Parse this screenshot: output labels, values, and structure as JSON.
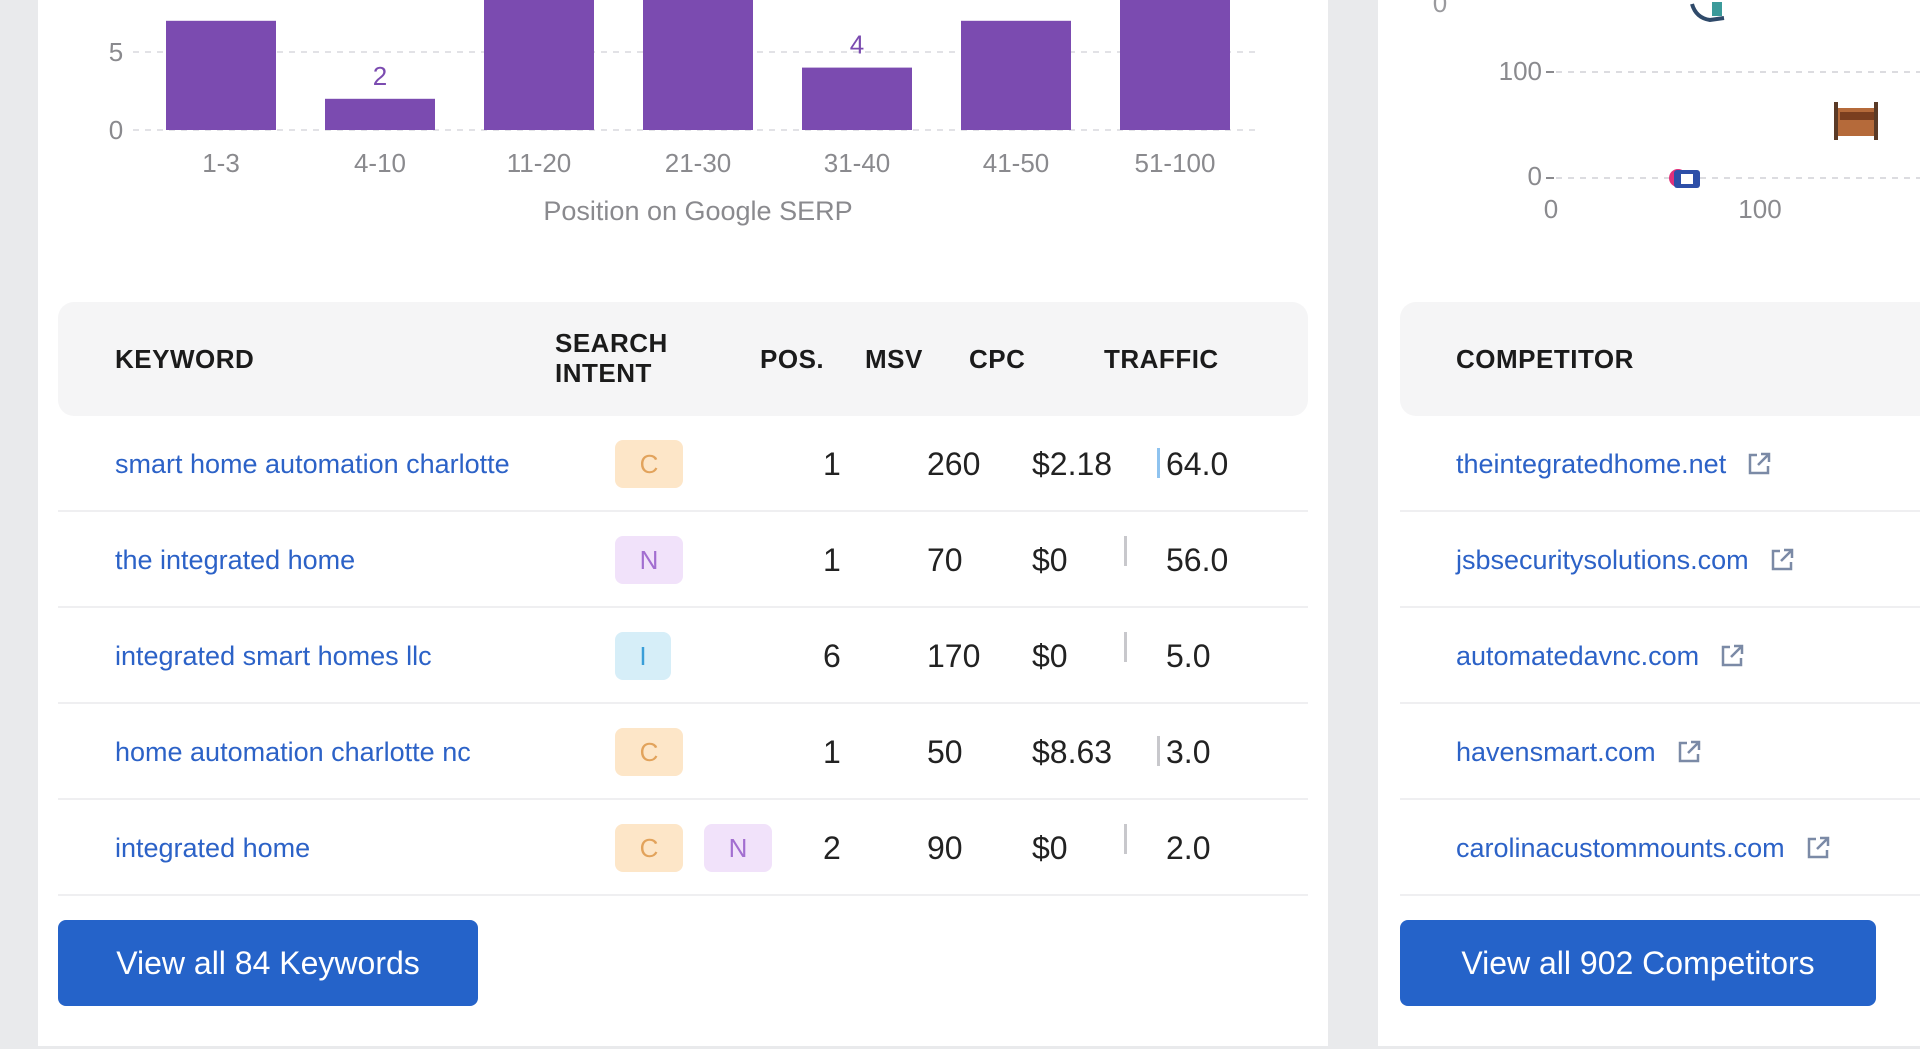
{
  "keywords_panel": {
    "chart_data": {
      "type": "bar",
      "xlabel": "Position on Google SERP",
      "categories": [
        "1-3",
        "4-10",
        "11-20",
        "21-30",
        "31-40",
        "41-50",
        "51-100"
      ],
      "values": [
        7,
        2,
        9,
        9,
        4,
        7,
        9
      ],
      "visible_value_labels": [
        null,
        "2",
        null,
        null,
        "4",
        null,
        null
      ],
      "y_ticks": [
        "0",
        "5"
      ],
      "ylim": [
        0,
        8.5
      ],
      "bar_color": "#7b4bb0"
    },
    "table": {
      "headers": {
        "keyword": "KEYWORD",
        "intent_line1": "SEARCH",
        "intent_line2": "INTENT",
        "pos": "POS.",
        "msv": "MSV",
        "cpc": "CPC",
        "traffic": "TRAFFIC"
      },
      "rows": [
        {
          "keyword": "smart home automation charlotte",
          "intents": [
            "C"
          ],
          "pos": "1",
          "msv": "260",
          "cpc": "$2.18",
          "traffic": "64.0"
        },
        {
          "keyword": "the integrated home",
          "intents": [
            "N"
          ],
          "pos": "1",
          "msv": "70",
          "cpc": "$0",
          "traffic": "56.0"
        },
        {
          "keyword": "integrated smart homes llc",
          "intents": [
            "I"
          ],
          "pos": "6",
          "msv": "170",
          "cpc": "$0",
          "traffic": "5.0"
        },
        {
          "keyword": "home automation charlotte nc",
          "intents": [
            "C"
          ],
          "pos": "1",
          "msv": "50",
          "cpc": "$8.63",
          "traffic": "3.0"
        },
        {
          "keyword": "integrated home",
          "intents": [
            "C",
            "N"
          ],
          "pos": "2",
          "msv": "90",
          "cpc": "$0",
          "traffic": "2.0"
        }
      ]
    },
    "view_all_label": "View all 84 Keywords"
  },
  "competitors_panel": {
    "scatter": {
      "y_ticks": [
        "100",
        "0"
      ],
      "x_ticks": [
        "0",
        "100"
      ],
      "top_left_partial": "0"
    },
    "table": {
      "header": "COMPETITOR",
      "rows": [
        "theintegratedhome.net",
        "jsbsecuritysolutions.com",
        "automatedavnc.com",
        "havensmart.com",
        "carolinacustommounts.com"
      ]
    },
    "view_all_label": "View all 902 Competitors"
  },
  "colors": {
    "link": "#2c62c7",
    "button": "#2563c9",
    "bar": "#7b4bb0"
  }
}
